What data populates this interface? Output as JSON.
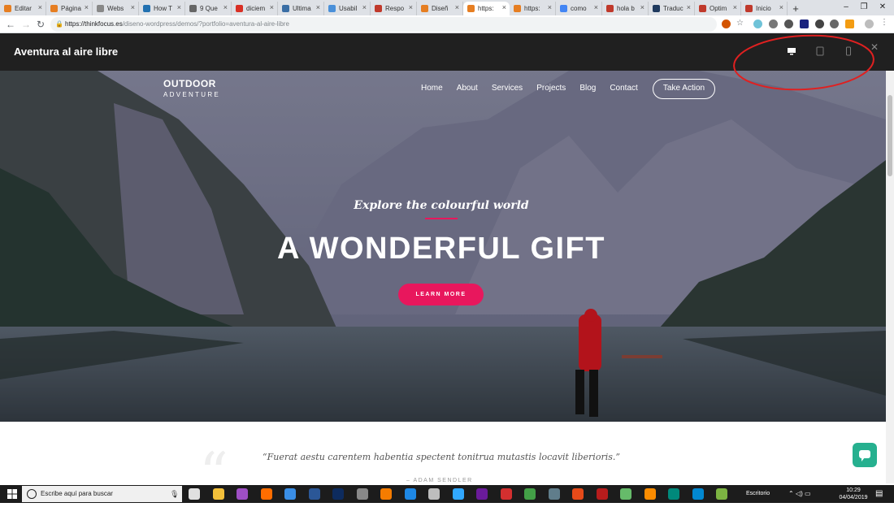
{
  "browser": {
    "tabs": [
      {
        "label": "Editar",
        "icon": "wordpress-icon",
        "color": "#e67e22"
      },
      {
        "label": "Página",
        "icon": "wordpress-icon",
        "color": "#e67e22"
      },
      {
        "label": "Webs",
        "icon": "document-icon",
        "color": "#888888"
      },
      {
        "label": "How T",
        "icon": "wp-icon",
        "color": "#2271b1"
      },
      {
        "label": "9 Que",
        "icon": "site-icon",
        "color": "#666666"
      },
      {
        "label": "diciem",
        "icon": "gmail-icon",
        "color": "#d93025"
      },
      {
        "label": "Ultima",
        "icon": "site-icon",
        "color": "#3a6ea5"
      },
      {
        "label": "Usabil",
        "icon": "site-icon",
        "color": "#4a90d9"
      },
      {
        "label": "Respo",
        "icon": "site-icon",
        "color": "#c0392b"
      },
      {
        "label": "Diseñ",
        "icon": "site-icon",
        "color": "#e67e22"
      },
      {
        "label": "https:",
        "icon": "site-icon",
        "color": "#e67e22",
        "active": true
      },
      {
        "label": "https:",
        "icon": "site-icon",
        "color": "#e67e22"
      },
      {
        "label": "como",
        "icon": "google-icon",
        "color": "#4285f4"
      },
      {
        "label": "hola b",
        "icon": "site-icon",
        "color": "#c0392b"
      },
      {
        "label": "Traduc",
        "icon": "site-icon",
        "color": "#1f3a5f"
      },
      {
        "label": "Optim",
        "icon": "site-icon",
        "color": "#c0392b"
      },
      {
        "label": "Inicio",
        "icon": "site-icon",
        "color": "#c0392b"
      }
    ],
    "new_tab": "+",
    "window_controls": {
      "minimize": "–",
      "restore": "❐",
      "close": "✕"
    },
    "url_host": "https://thinkfocus.es",
    "url_path": "/diseno-wordpress/demos/?portfolio=aventura-al-aire-libre",
    "nav": {
      "back": "←",
      "forward": "→",
      "reload": "↻"
    }
  },
  "demo_bar": {
    "title": "Aventura al aire libre",
    "close": "✕",
    "devices": [
      "desktop-icon",
      "tablet-icon",
      "mobile-icon"
    ],
    "annotation_color": "#e02020"
  },
  "site": {
    "logo_top": "OUTDOOR",
    "logo_bottom": "ADVENTURE",
    "menu": [
      "Home",
      "About",
      "Services",
      "Projects",
      "Blog",
      "Contact"
    ],
    "cta": "Take Action",
    "subheading": "Explore the colourful world",
    "headline": "A WONDERFUL GIFT",
    "button": "LEARN MORE",
    "quote": "“Fuerat aestu carentem habentia spectent tonitrua mutastis locavit liberioris.”",
    "quote_author": "– ADAM SENDLER",
    "accent": "#e8175d",
    "chat_color": "#26b08f"
  },
  "taskbar": {
    "search_placeholder": "Escribe aquí para buscar",
    "desktop_label": "Escritorio",
    "time": "10:29",
    "date": "04/04/2019"
  }
}
